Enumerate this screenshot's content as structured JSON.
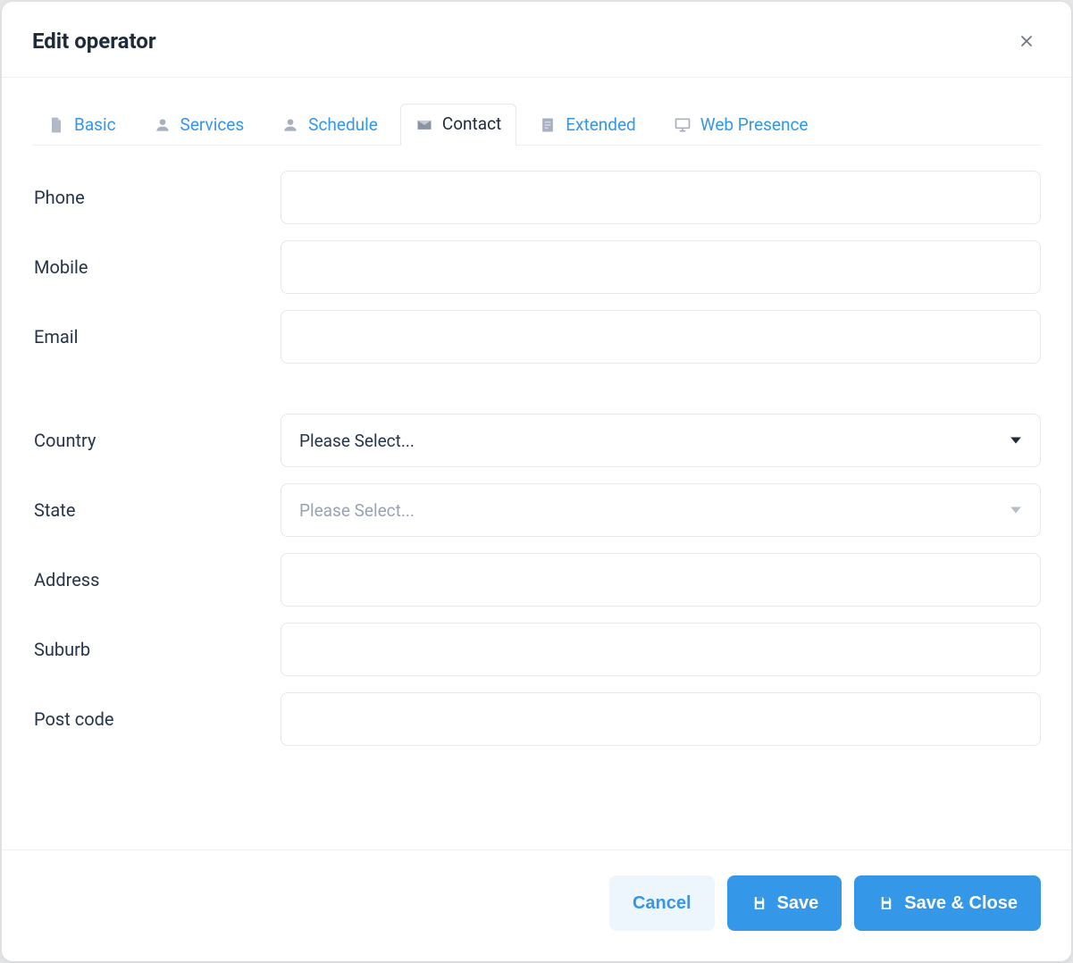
{
  "modal": {
    "title": "Edit operator"
  },
  "tabs": {
    "basic": "Basic",
    "services": "Services",
    "schedule": "Schedule",
    "contact": "Contact",
    "extended": "Extended",
    "web_presence": "Web Presence",
    "active": "contact"
  },
  "form": {
    "phone": {
      "label": "Phone",
      "value": ""
    },
    "mobile": {
      "label": "Mobile",
      "value": ""
    },
    "email": {
      "label": "Email",
      "value": ""
    },
    "country": {
      "label": "Country",
      "placeholder": "Please Select...",
      "value": ""
    },
    "state": {
      "label": "State",
      "placeholder": "Please Select...",
      "value": "",
      "disabled": true
    },
    "address": {
      "label": "Address",
      "value": ""
    },
    "suburb": {
      "label": "Suburb",
      "value": ""
    },
    "postcode": {
      "label": "Post code",
      "value": ""
    }
  },
  "footer": {
    "cancel": "Cancel",
    "save": "Save",
    "save_close": "Save & Close"
  }
}
